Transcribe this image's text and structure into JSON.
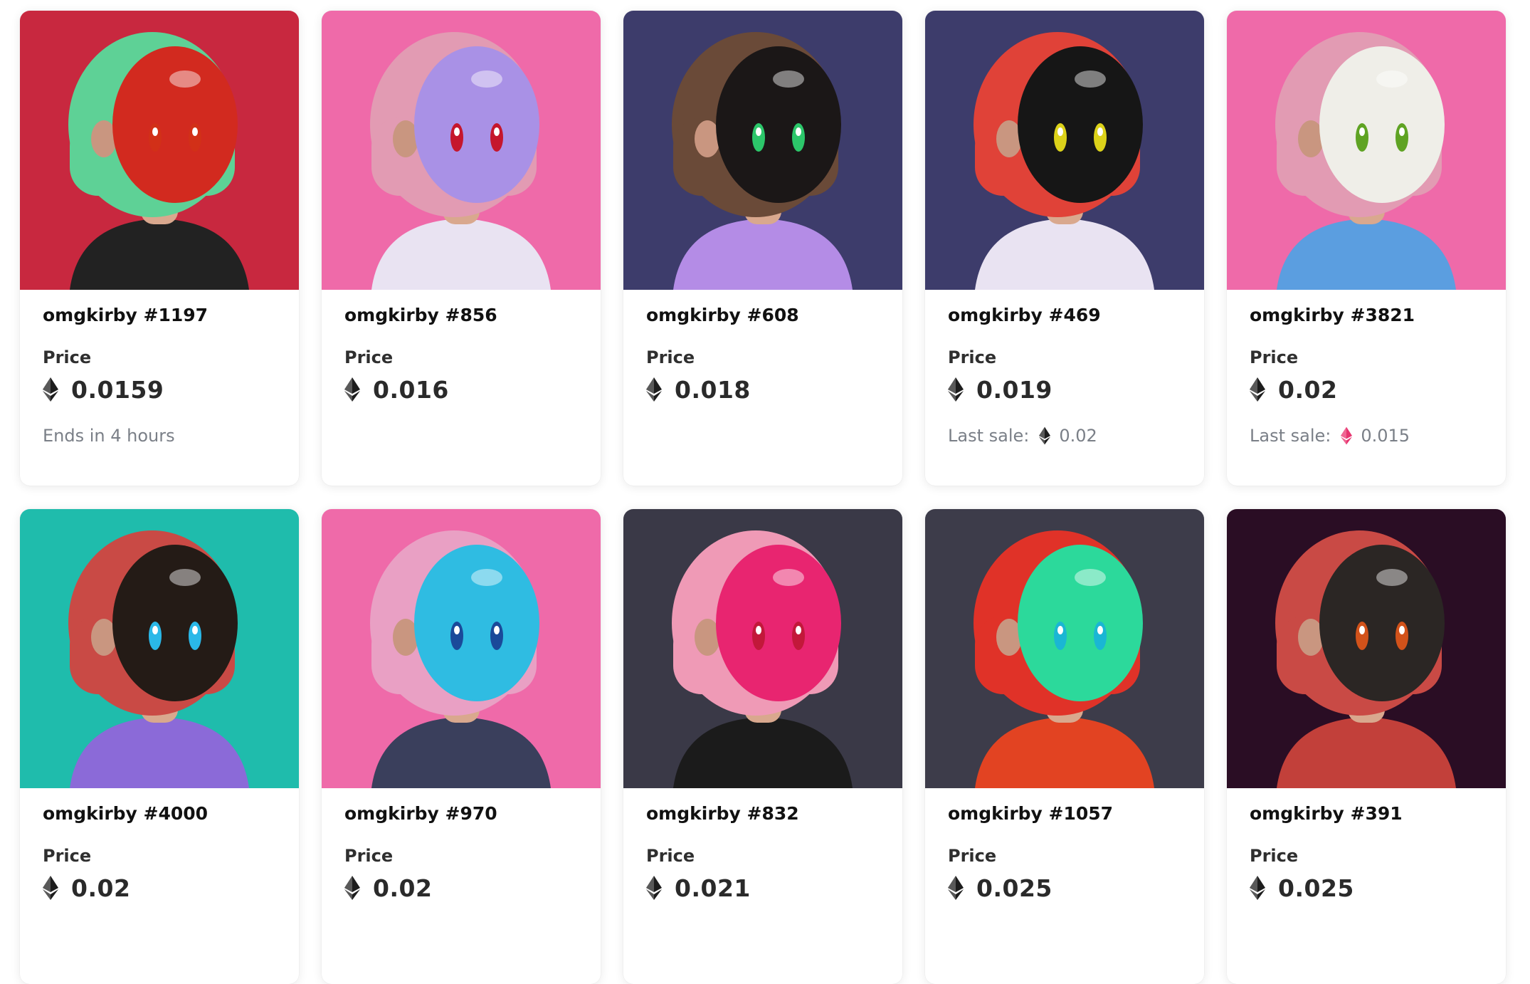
{
  "price_label": "Price",
  "last_sale_label": "Last sale:",
  "cards": [
    {
      "title": "omgkirby #1197",
      "price": "0.0159",
      "footer_text": "Ends in 4 hours",
      "footer_type": "ends",
      "bg": "#c8283f",
      "hair": "#5ed196",
      "mask": "#d22a1f",
      "eye": "#d23018",
      "outfit": "#222222"
    },
    {
      "title": "omgkirby #856",
      "price": "0.016",
      "footer_text": "",
      "footer_type": "none",
      "bg": "#ef6aa9",
      "hair": "#e29bb3",
      "mask": "#a991e6",
      "eye": "#c5162d",
      "outfit": "#e9e3f2"
    },
    {
      "title": "omgkirby #608",
      "price": "0.018",
      "footer_text": "",
      "footer_type": "none",
      "bg": "#3d3c6b",
      "hair": "#6a4a38",
      "mask": "#1b1717",
      "eye": "#2cc66a",
      "outfit": "#b48ce6"
    },
    {
      "title": "omgkirby #469",
      "price": "0.019",
      "footer_text": "0.02",
      "footer_type": "last-eth",
      "bg": "#3d3c6b",
      "hair": "#e04238",
      "mask": "#161616",
      "eye": "#dcd21a",
      "outfit": "#e9e3f2"
    },
    {
      "title": "omgkirby #3821",
      "price": "0.02",
      "footer_text": "0.015",
      "footer_type": "last-pink",
      "bg": "#ef6aa9",
      "hair": "#e29bb3",
      "mask": "#efeee8",
      "eye": "#5fa323",
      "outfit": "#5b9ee0"
    },
    {
      "title": "omgkirby #4000",
      "price": "0.02",
      "footer_text": "",
      "footer_type": "none",
      "bg": "#1fbcac",
      "hair": "#c94a45",
      "mask": "#241b16",
      "eye": "#2ab8e8",
      "outfit": "#8b6ad8"
    },
    {
      "title": "omgkirby #970",
      "price": "0.02",
      "footer_text": "",
      "footer_type": "none",
      "bg": "#ef6aa9",
      "hair": "#e9a0c4",
      "mask": "#2fbce2",
      "eye": "#1a4a9a",
      "outfit": "#3a3f5c"
    },
    {
      "title": "omgkirby #832",
      "price": "0.021",
      "footer_text": "",
      "footer_type": "none",
      "bg": "#3a3947",
      "hair": "#ef9ab6",
      "mask": "#e82570",
      "eye": "#c2183a",
      "outfit": "#1b1b1b"
    },
    {
      "title": "omgkirby #1057",
      "price": "0.025",
      "footer_text": "",
      "footer_type": "none",
      "bg": "#3d3c4a",
      "hair": "#e03228",
      "mask": "#2cd99b",
      "eye": "#1ab6d4",
      "outfit": "#e24322"
    },
    {
      "title": "omgkirby #391",
      "price": "0.025",
      "footer_text": "",
      "footer_type": "none",
      "bg": "#2a0d24",
      "hair": "#c94a45",
      "mask": "#2b2624",
      "eye": "#d2521a",
      "outfit": "#c2403a"
    }
  ]
}
